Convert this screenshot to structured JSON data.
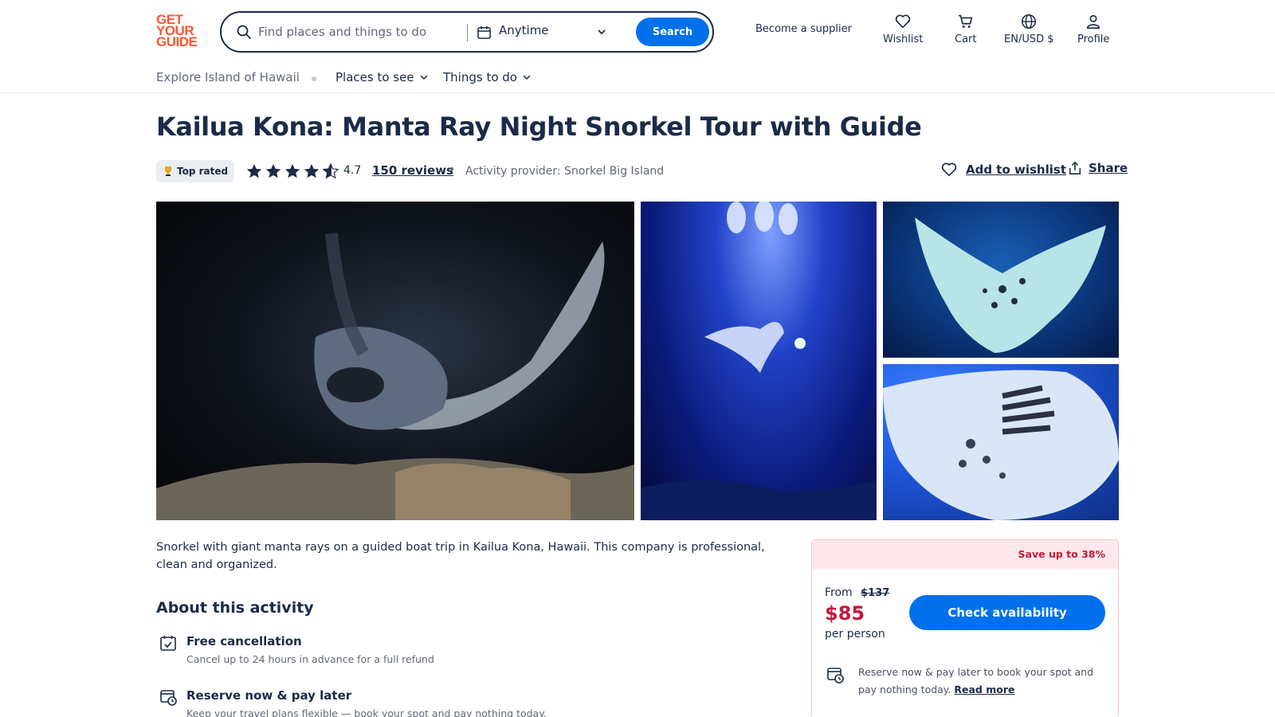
{
  "header": {
    "logo": [
      "GET",
      "YOUR",
      "GUIDE"
    ],
    "search": {
      "placeholder": "Find places and things to do",
      "date_label": "Anytime",
      "button_label": "Search"
    },
    "supplier_link": "Become a supplier",
    "actions": {
      "wishlist": "Wishlist",
      "cart": "Cart",
      "locale": "EN/USD $",
      "profile": "Profile"
    },
    "subnav": {
      "explore": "Explore Island of Hawaii",
      "places": "Places to see",
      "things": "Things to do"
    }
  },
  "activity": {
    "title": "Kailua Kona: Manta Ray Night Snorkel Tour with Guide",
    "badge": "Top rated",
    "rating": "4.7",
    "rating_value": 4.7,
    "reviews": "150 reviews",
    "bullet": "•",
    "provider": "Activity provider: Snorkel Big Island",
    "add_to_wishlist": "Add to wishlist",
    "share": "Share",
    "description": "Snorkel with giant manta rays on a guided boat trip in Kailua Kona, Hawaii. This company is professional, clean and organized."
  },
  "about": {
    "title": "About this activity",
    "features": [
      {
        "title": "Free cancellation",
        "subtitle": "Cancel up to 24 hours in advance for a full refund"
      },
      {
        "title": "Reserve now & pay later",
        "subtitle": "Keep your travel plans flexible — book your spot and pay nothing today."
      }
    ]
  },
  "booking": {
    "save_banner": "Save up to 38%",
    "from_label": "From",
    "old_price": "$137",
    "price": "$85",
    "per_person": "per person",
    "cta": "Check availability",
    "note": "Reserve now & pay later to book your spot and pay nothing today.",
    "read_more": "Read more"
  },
  "colors": {
    "primary_blue": "#0071eb",
    "brand_orange": "#ff5533",
    "price_red": "#c2193a",
    "text_dark": "#1a2b49"
  }
}
